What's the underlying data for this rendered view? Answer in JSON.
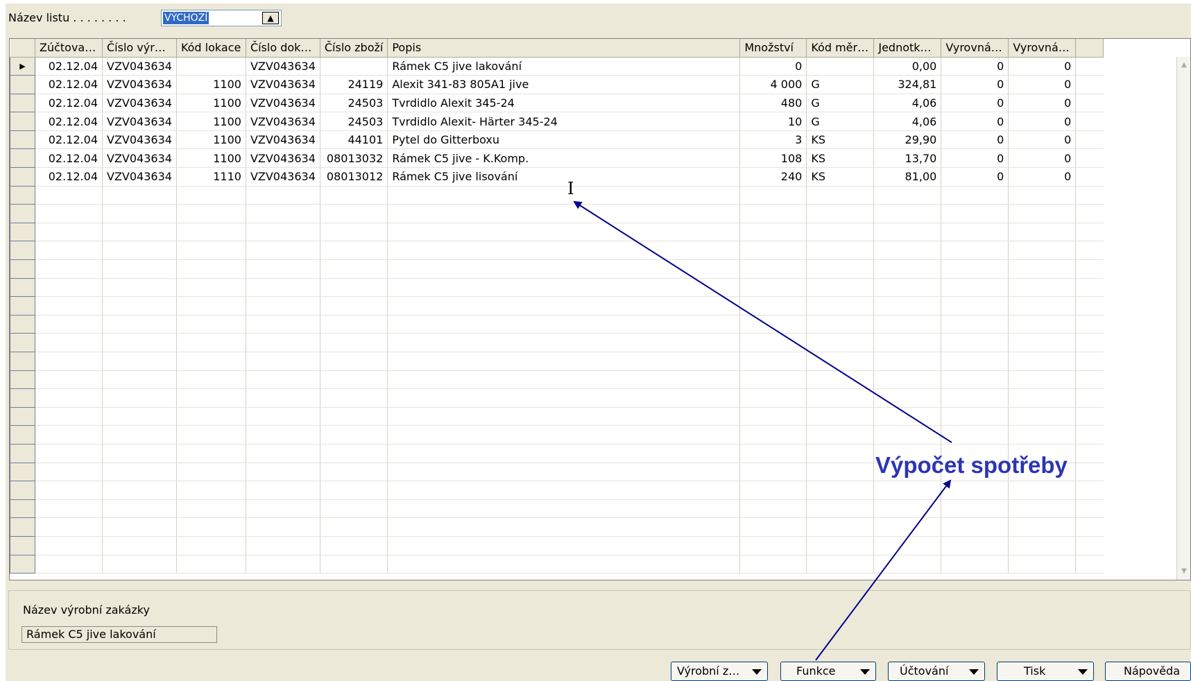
{
  "sheet": {
    "label": "Název listu . . . . . . . .",
    "value": "VÝCHOZÍ"
  },
  "grid": {
    "columns": [
      "Zúčtova…",
      "Číslo výr…",
      "Kód lokace",
      "Číslo dok…",
      "Číslo zboží",
      "Popis",
      "Množství",
      "Kód měr…",
      "Jednotk…",
      "Vyrovná…",
      "Vyrovná…"
    ],
    "rows": [
      [
        "02.12.04",
        "VZV043634",
        "",
        "VZV043634",
        "",
        "Rámek C5 jive lakování",
        "0",
        "",
        "0,00",
        "0",
        "0"
      ],
      [
        "02.12.04",
        "VZV043634",
        "1100",
        "VZV043634",
        "24119",
        "Alexit 341-83 805A1 jive",
        "4 000",
        "G",
        "324,81",
        "0",
        "0"
      ],
      [
        "02.12.04",
        "VZV043634",
        "1100",
        "VZV043634",
        "24503",
        "Tvrdidlo Alexit 345-24",
        "480",
        "G",
        "4,06",
        "0",
        "0"
      ],
      [
        "02.12.04",
        "VZV043634",
        "1100",
        "VZV043634",
        "24503",
        "Tvrdidlo Alexit- Härter 345-24",
        "10",
        "G",
        "4,06",
        "0",
        "0"
      ],
      [
        "02.12.04",
        "VZV043634",
        "1100",
        "VZV043634",
        "44101",
        "Pytel do Gitterboxu",
        "3",
        "KS",
        "29,90",
        "0",
        "0"
      ],
      [
        "02.12.04",
        "VZV043634",
        "1100",
        "VZV043634",
        "08013032",
        "Rámek C5 jive - K.Komp.",
        "108",
        "KS",
        "13,70",
        "0",
        "0"
      ],
      [
        "02.12.04",
        "VZV043634",
        "1110",
        "VZV043634",
        "08013012",
        "Rámek C5 jive lisování",
        "240",
        "KS",
        "81,00",
        "0",
        "0"
      ]
    ],
    "selected_row_marker": "▶"
  },
  "info": {
    "label": "Název výrobní zakázky",
    "value": "Rámek C5 jive lakování"
  },
  "buttons": {
    "production": "Výrobní z…",
    "functions": "Funkce",
    "posting": "Účtování",
    "print": "Tisk",
    "help": "Nápověda"
  },
  "annotation": {
    "text": "Výpočet spotřeby",
    "color": "#2b35b5"
  },
  "colors": {
    "window_bg": "#ece9d8",
    "selection": "#316ac5",
    "arrow": "#00008b"
  }
}
